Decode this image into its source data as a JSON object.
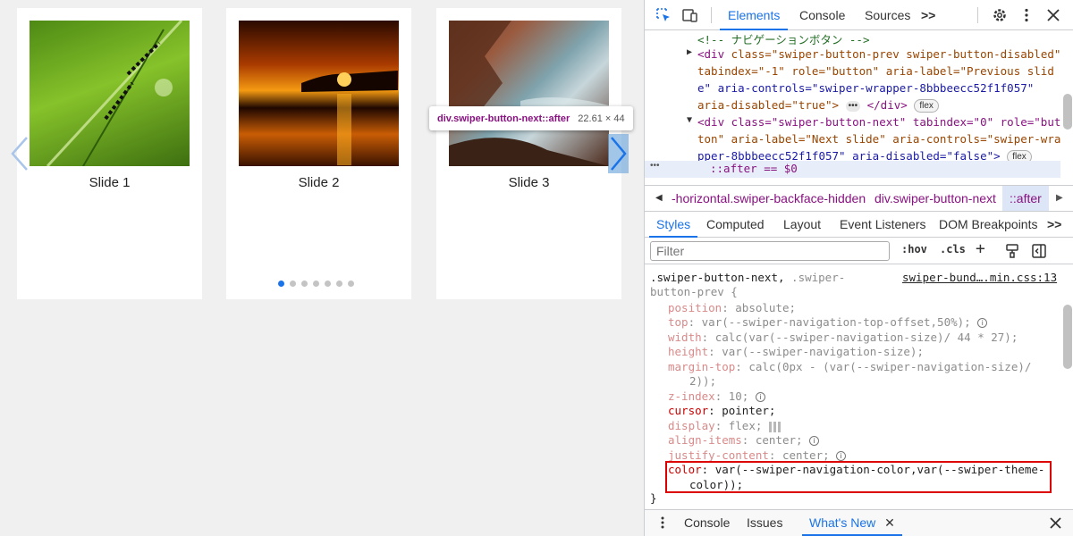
{
  "page": {
    "slides": [
      {
        "caption": "Slide 1"
      },
      {
        "caption": "Slide 2"
      },
      {
        "caption": "Slide 3"
      }
    ],
    "pagination_count": 7,
    "active_dot": 0,
    "tooltip": {
      "name": "div.swiper-button-next::after",
      "size": "22.61 × 44"
    },
    "accent_color": "#1a73e8"
  },
  "devtools": {
    "top_tabs": [
      "Elements",
      "Console",
      "Sources"
    ],
    "more_tabs": ">>",
    "elements": {
      "comment": "<!-- ナビゲーションボタン -->",
      "prev_div": {
        "class_attr": "class=\"swiper-button-prev swiper-button-disabled\"",
        "l2": "tabindex=\"-1\" role=\"button\" aria-label=\"Previous slid",
        "l3": "e\" aria-controls=\"swiper-wrapper-8bbbeecc52f1f057\"",
        "l4": "aria-disabled=\"true\">",
        "close": "</div>",
        "badge": "flex"
      },
      "next_div": {
        "l1": "<div class=\"swiper-button-next\" tabindex=\"0\" role=\"but",
        "l2": "ton\" aria-label=\"Next slide\" aria-controls=\"swiper-wra",
        "l3": "pper-8bbbeecc52f1f057\" aria-disabled=\"false\">",
        "badge": "flex"
      },
      "after_line": "::after == $0",
      "ellipsis_left": "•••"
    },
    "breadcrumbs": [
      "-horizontal.swiper-backface-hidden",
      "div.swiper-button-next",
      "::after"
    ],
    "style_tabs": [
      "Styles",
      "Computed",
      "Layout",
      "Event Listeners",
      "DOM Breakpoints"
    ],
    "filter_placeholder": "Filter",
    "filter_buttons": [
      ":hov",
      ".cls",
      "+"
    ],
    "styles": {
      "selector_a": ".swiper-button-next,",
      "selector_b": " .swiper-",
      "selector_c": "button-prev {",
      "source": "swiper-bund….min.css:13",
      "rules": [
        {
          "name": "position",
          "value": "absolute;"
        },
        {
          "name": "top",
          "value": "var(--swiper-navigation-top-offset,50%);"
        },
        {
          "name": "width",
          "value": "calc(var(--swiper-navigation-size)/ 44 * 27);"
        },
        {
          "name": "height",
          "value": "var(--swiper-navigation-size);"
        },
        {
          "name": "margin-top",
          "value": "calc(0px - (var(--swiper-navigation-size)/",
          "cont": "2));"
        },
        {
          "name": "z-index",
          "value": "10;"
        },
        {
          "name": "cursor",
          "value": "pointer;"
        },
        {
          "name": "display",
          "value": "flex;"
        },
        {
          "name": "align-items",
          "value": "center;"
        },
        {
          "name": "justify-content",
          "value": "center;"
        },
        {
          "name": "color",
          "value": "var(--swiper-navigation-color,var(--swiper-theme-",
          "cont": "color));"
        }
      ],
      "closing_brace": "}"
    },
    "drawer_tabs": [
      "Console",
      "Issues",
      "What's New"
    ]
  }
}
